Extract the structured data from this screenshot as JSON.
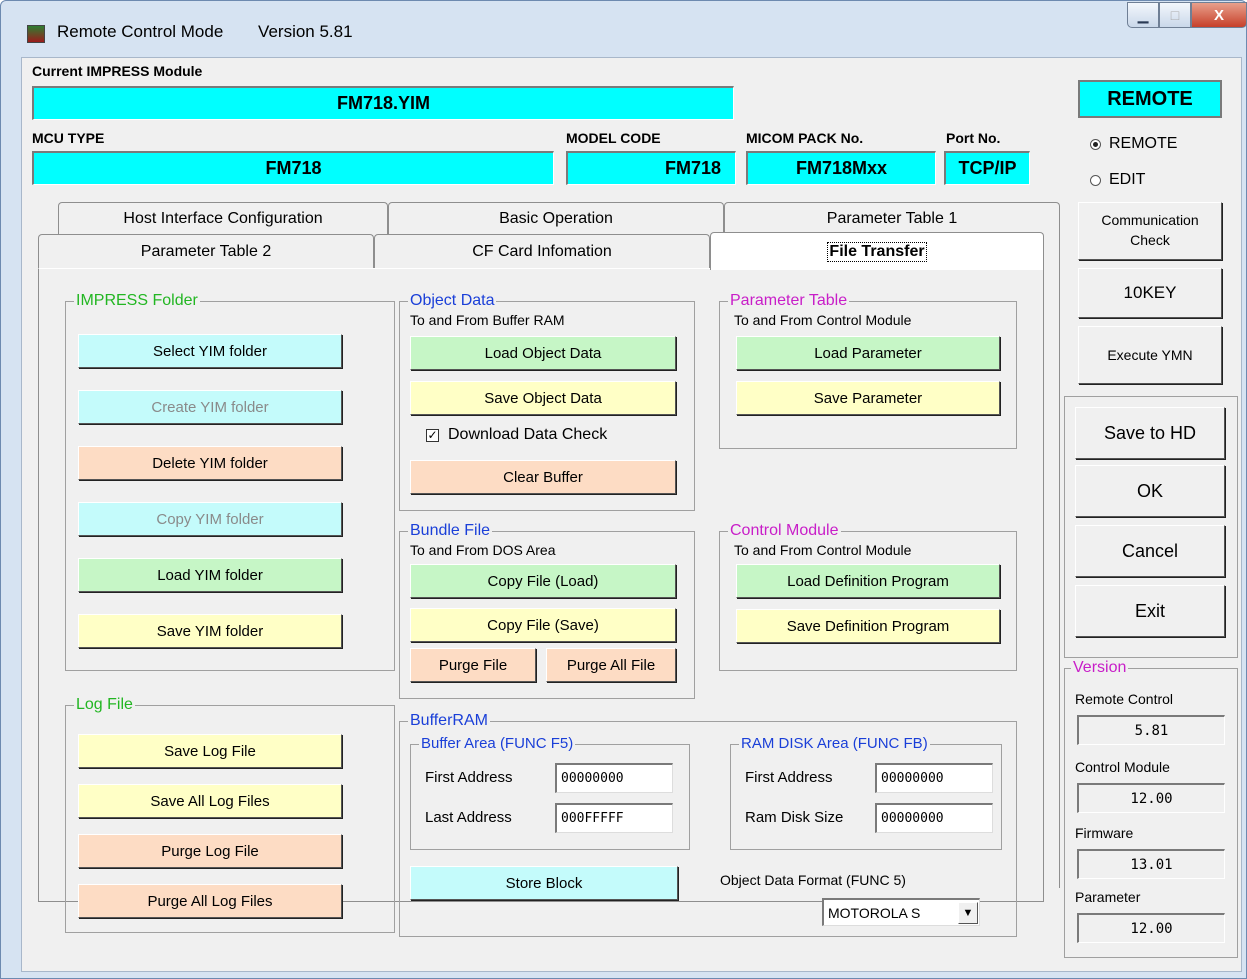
{
  "window": {
    "title": "Remote Control Mode",
    "version": "Version  5.81",
    "controls": {
      "minimize": "▁",
      "maximize": "□",
      "close": "X"
    }
  },
  "header": {
    "current_module_label": "Current IMPRESS Module",
    "current_module_value": "FM718.YIM",
    "mcu_type_label": "MCU TYPE",
    "mcu_type_value": "FM718",
    "model_code_label": "MODEL CODE",
    "model_code_value": "FM718",
    "micom_pack_label": "MICOM PACK No.",
    "micom_pack_value": "FM718Mxx",
    "port_label": "Port No.",
    "port_value": "TCP/IP"
  },
  "mode": {
    "indicator": "REMOTE",
    "options": [
      {
        "label": "REMOTE",
        "selected": true
      },
      {
        "label": "EDIT",
        "selected": false
      }
    ]
  },
  "tabs": {
    "row1": [
      "Host Interface Configuration",
      "Basic Operation",
      "Parameter Table 1"
    ],
    "row2": [
      "Parameter Table 2",
      "CF Card Infomation",
      "File Transfer"
    ],
    "active": "File Transfer"
  },
  "impress_folder": {
    "title": "IMPRESS Folder",
    "buttons": [
      {
        "label": "Select YIM folder",
        "color": "cyan",
        "enabled": true
      },
      {
        "label": "Create YIM folder",
        "color": "cyan",
        "enabled": false
      },
      {
        "label": "Delete YIM folder",
        "color": "peach",
        "enabled": true
      },
      {
        "label": "Copy YIM folder",
        "color": "cyan",
        "enabled": false
      },
      {
        "label": "Load YIM folder",
        "color": "green",
        "enabled": true
      },
      {
        "label": "Save YIM folder",
        "color": "yellow",
        "enabled": true
      }
    ]
  },
  "log_file": {
    "title": "Log File",
    "buttons": [
      {
        "label": "Save Log File",
        "color": "yellow"
      },
      {
        "label": "Save All Log Files",
        "color": "yellow"
      },
      {
        "label": "Purge Log File",
        "color": "peach"
      },
      {
        "label": "Purge All Log Files",
        "color": "peach"
      }
    ]
  },
  "object_data": {
    "title": "Object Data",
    "subtitle": "To and From Buffer RAM",
    "load": "Load Object Data",
    "save": "Save Object Data",
    "checkbox_label": "Download Data Check",
    "checkbox_checked": true,
    "checkmark": "✓",
    "clear": "Clear Buffer"
  },
  "parameter_table": {
    "title": "Parameter Table",
    "subtitle": "To and From Control Module",
    "load": "Load Parameter",
    "save": "Save Parameter"
  },
  "bundle_file": {
    "title": "Bundle File",
    "subtitle": "To and From DOS Area",
    "copy_load": "Copy File (Load)",
    "copy_save": "Copy File (Save)",
    "purge": "Purge File",
    "purge_all": "Purge All File"
  },
  "control_module": {
    "title": "Control Module",
    "subtitle": "To and From Control Module",
    "load": "Load Definition Program",
    "save": "Save Definition Program"
  },
  "buffer_ram": {
    "title": "BufferRAM",
    "buffer_area": {
      "title": "Buffer Area (FUNC F5)",
      "first_label": "First  Address",
      "first_value": "00000000",
      "last_label": "Last  Address",
      "last_value": "000FFFFF"
    },
    "ram_disk": {
      "title": "RAM DISK Area (FUNC FB)",
      "first_label": "First  Address",
      "first_value": "00000000",
      "size_label": "Ram Disk Size",
      "size_value": "00000000"
    },
    "store_block": "Store Block",
    "format_label": "Object Data Format (FUNC 5)",
    "format_value": "MOTOROLA S",
    "dropdown_arrow": "▼"
  },
  "side_buttons": {
    "communication": "Communication\nCheck",
    "tenkey": "10KEY",
    "execute": "Execute YMN",
    "save_hd": "Save to HD",
    "ok": "OK",
    "cancel": "Cancel",
    "exit": "Exit"
  },
  "version_panel": {
    "title": "Version",
    "items": [
      {
        "label": "Remote Control",
        "value": "5.81"
      },
      {
        "label": "Control Module",
        "value": "12.00"
      },
      {
        "label": "Firmware",
        "value": "13.01"
      },
      {
        "label": "Parameter",
        "value": "12.00"
      }
    ]
  },
  "colors": {
    "cyan_field": "#00ffff",
    "btn_cyan": "#c4fbfb",
    "btn_green": "#c6f6c6",
    "btn_yellow": "#ffffc6",
    "btn_peach": "#fddcc4",
    "green_title": "#22b622",
    "magenta_title": "#c81ec8",
    "blue_title": "#1a3fd8"
  }
}
